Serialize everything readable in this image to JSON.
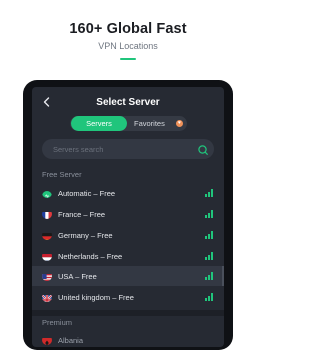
{
  "promo": {
    "headline": "160+ Global Fast",
    "subline": "VPN Locations",
    "accent_color": "#20c57c"
  },
  "nav": {
    "back_icon": "chevron-left-icon",
    "title": "Select Server"
  },
  "tabs": {
    "servers": "Servers",
    "favorites": "Favorites",
    "favorites_badge": "♥"
  },
  "search": {
    "placeholder": "Servers search",
    "icon": "search-icon"
  },
  "free_section": {
    "label": "Free Server",
    "items": [
      {
        "label": "Automatic – Free",
        "flag": "globe-icon",
        "signal_bars": 4
      },
      {
        "label": "France – Free",
        "flag": "france-flag-icon",
        "signal_bars": 4
      },
      {
        "label": "Germany – Free",
        "flag": "germany-flag-icon",
        "signal_bars": 4
      },
      {
        "label": "Netherlands – Free",
        "flag": "netherlands-flag-icon",
        "signal_bars": 4
      },
      {
        "label": "USA – Free",
        "flag": "usa-flag-icon",
        "signal_bars": 4,
        "selected": true
      },
      {
        "label": "United kingdom – Free",
        "flag": "uk-flag-icon",
        "signal_bars": 4
      }
    ]
  },
  "premium_section": {
    "label": "Premium",
    "items": [
      {
        "label": "Albania",
        "flag": "albania-flag-icon"
      }
    ]
  },
  "colors": {
    "screen_bg": "#262a33",
    "selected_row": "#333843",
    "signal": "#20c57c"
  }
}
